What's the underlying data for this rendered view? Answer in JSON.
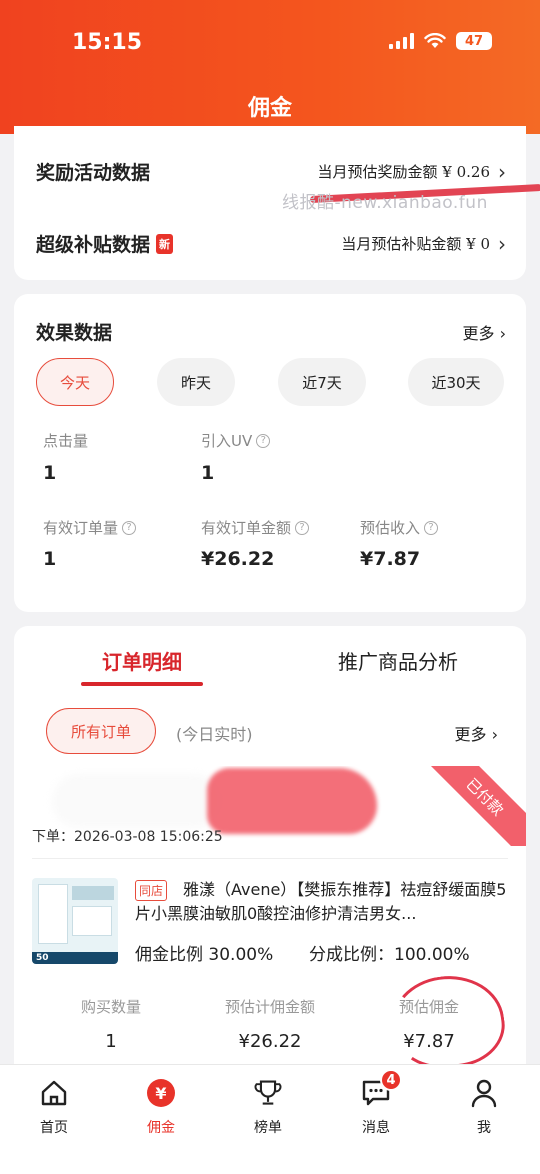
{
  "status_bar": {
    "time": "15:15",
    "battery": "47"
  },
  "page_title": "佣金",
  "rewards": {
    "activity_title": "奖励活动数据",
    "activity_value": "当月预估奖励金额 ¥ 0.26",
    "subsidy_title": "超级补贴数据",
    "subsidy_badge": "新",
    "subsidy_value": "当月预估补贴金额 ¥ 0",
    "watermark": "线报酷-new.xianbao.fun"
  },
  "effect": {
    "title": "效果数据",
    "more": "更多 ›",
    "filters": [
      "今天",
      "昨天",
      "近7天",
      "近30天"
    ],
    "metrics": [
      {
        "label": "点击量",
        "value": "1"
      },
      {
        "label": "引入UV",
        "value": "1"
      },
      {
        "label": "有效订单量",
        "value": "1"
      },
      {
        "label": "有效订单金额",
        "value": "¥26.22"
      },
      {
        "label": "预估收入",
        "value": "¥7.87"
      }
    ]
  },
  "orders": {
    "tabs": [
      "订单明细",
      "推广商品分析"
    ],
    "filter_all": "所有订单",
    "realtime": "(今日实时)",
    "more": "更多 ›",
    "status": "已付款",
    "order_time": "下单：2026-03-08 15:06:25",
    "shop_tag": "同店",
    "product_title": "雅漾（Avene）【樊振东推荐】祛痘舒缓面膜5片小黑膜油敏肌0酸控油修护清洁男女...",
    "commission_rate": "佣金比例 30.00%",
    "share_rate": "分成比例：100.00%",
    "stats": [
      {
        "label": "购买数量",
        "value": "1"
      },
      {
        "label": "预估计佣金额",
        "value": "¥26.22"
      },
      {
        "label": "预估佣金",
        "value": "¥7.87"
      }
    ],
    "thumb_badge": "50"
  },
  "nav": {
    "items": [
      {
        "label": "首页",
        "icon": "home-icon"
      },
      {
        "label": "佣金",
        "icon": "yen-icon"
      },
      {
        "label": "榜单",
        "icon": "trophy-icon"
      },
      {
        "label": "消息",
        "icon": "message-icon",
        "badge": "4"
      },
      {
        "label": "我",
        "icon": "user-icon"
      }
    ]
  },
  "colors": {
    "accent": "#e8332a",
    "header": "#f4561e"
  }
}
